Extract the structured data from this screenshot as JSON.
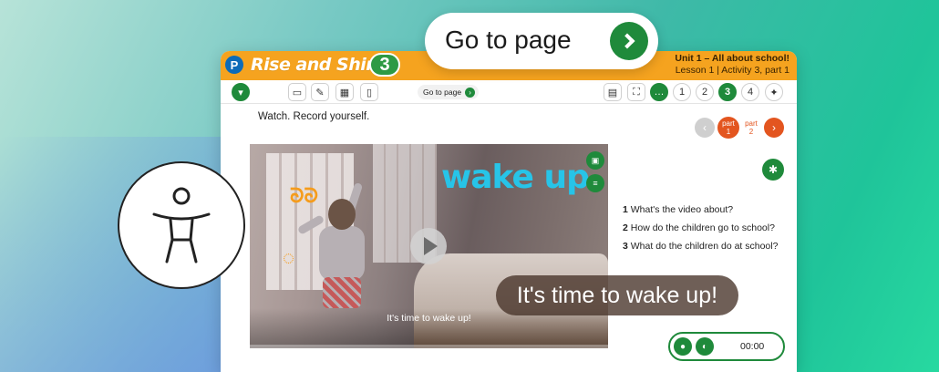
{
  "callouts": {
    "goto_page_label": "Go to page",
    "subtitle_large": "It's time to wake up!"
  },
  "app": {
    "brand": "Rise and Shine",
    "level": "3",
    "publisher_logo": "P",
    "unit_title": "Unit 1 – All about school!",
    "lesson_title": "Lesson 1 | Activity 3, part 1"
  },
  "toolbar": {
    "goto_label": "Go to page",
    "pages": [
      "1",
      "2",
      "3",
      "4"
    ],
    "active_page": "3",
    "icons": [
      "expand-down-icon",
      "presentation-icon",
      "notebook-icon",
      "grid-icon",
      "document-icon",
      "book-icon",
      "screen-capture-icon",
      "chat-icon",
      "sparkle-icon"
    ]
  },
  "activity": {
    "instruction": "Watch. Record yourself.",
    "parts": [
      {
        "word": "part",
        "num": "1"
      },
      {
        "word": "part",
        "num": "2"
      }
    ],
    "video": {
      "title_overlay": "wake up",
      "caption": "It's time to wake up!",
      "progress": 0
    },
    "questions": [
      {
        "num": "1",
        "text": "What's the video about?"
      },
      {
        "num": "2",
        "text": "How do the children go to school?"
      },
      {
        "num": "3",
        "text": "What do the children do at school?"
      }
    ],
    "recorder": {
      "time": "00:00"
    }
  },
  "colors": {
    "brand_orange": "#f5a31f",
    "accent_green": "#1f8a3b",
    "part_orange": "#e3551f",
    "video_title": "#27c4e8"
  }
}
